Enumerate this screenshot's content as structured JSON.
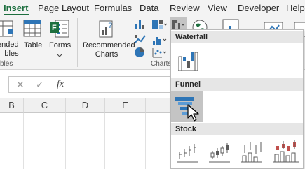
{
  "tabs": [
    "Insert",
    "Page Layout",
    "Formulas",
    "Data",
    "Review",
    "View",
    "Developer",
    "Help"
  ],
  "ribbon": {
    "recommended_pivot_partial": "ended\nbles",
    "table_label": "Table",
    "forms_label": "Forms",
    "recommended_charts_label": "Recommended\nCharts",
    "charts_group_label": "Charts",
    "tables_group_partial": "bles"
  },
  "formula_bar": {
    "cancel_symbol": "✕",
    "enter_symbol": "✓",
    "fx_symbol": "fx",
    "value": ""
  },
  "columns": [
    "B",
    "C",
    "D",
    "E"
  ],
  "dropdown": {
    "sections": [
      {
        "title": "Waterfall",
        "items": [
          "waterfall-chart"
        ]
      },
      {
        "title": "Funnel",
        "items": [
          "funnel-chart"
        ]
      },
      {
        "title": "Stock",
        "items": [
          "high-low-close",
          "open-high-low-close",
          "volume-high-low-close",
          "volume-open-high-low-close"
        ]
      }
    ]
  },
  "colors": {
    "accent_green": "#1d6f3f",
    "chart_blue": "#2e75b6",
    "ribbon_bg": "#f3f3f3"
  }
}
